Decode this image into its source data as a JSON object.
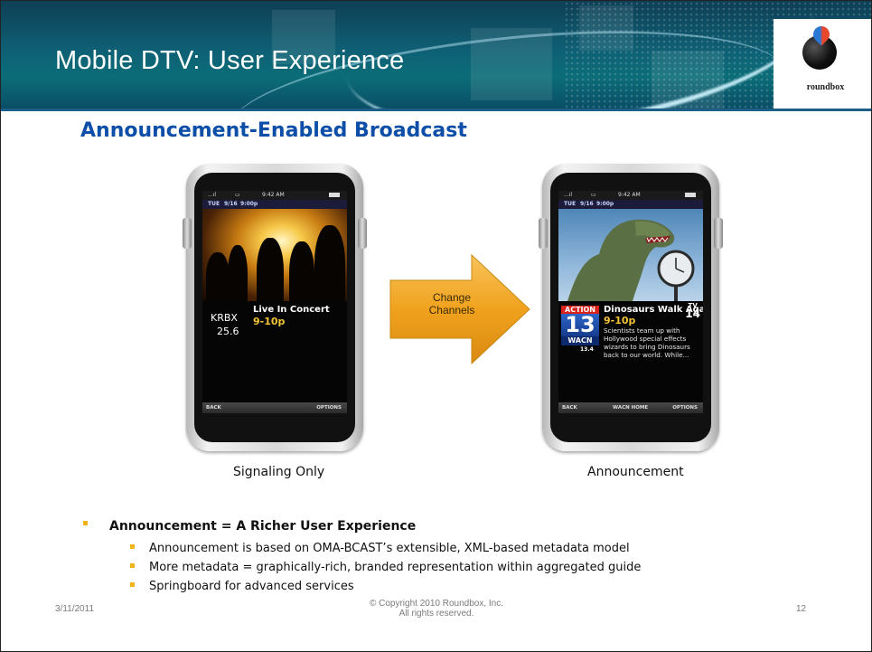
{
  "header": {
    "title": "Mobile DTV: User Experience",
    "logo_text": "roundbox"
  },
  "subtitle": "Announcement-Enabled Broadcast",
  "phone_left": {
    "status": {
      "signal": "...ıl",
      "battery_glyph": "▭",
      "time": "9:42 AM"
    },
    "date": {
      "day": "TUE",
      "date": "9/16",
      "time": "9:00p"
    },
    "channel_call": "KRBX",
    "channel_num": "25.6",
    "program_title": "Live In Concert",
    "program_time": "9-10p",
    "back_label": "BACK",
    "options_label": "OPTIONS",
    "caption": "Signaling Only"
  },
  "arrow_label": "Change Channels",
  "phone_right": {
    "status": {
      "signal": "...ıl",
      "battery_glyph": "▭",
      "time": "9:42 AM"
    },
    "date": {
      "day": "TUE",
      "date": "9/16",
      "time": "9:00p"
    },
    "station_logo_top": "ACTION",
    "station_logo_num": "13",
    "station_logo_call": "WACN",
    "channel_num": "13.4",
    "program_title": "Dinosaurs Walk Again",
    "program_time": "9-10p",
    "rating_top": "TV",
    "rating_num": "14",
    "description": "Scientists team up with Hollywood special effects wizards to bring Dinosaurs back to our world. While...",
    "back_label": "BACK",
    "home_label": "WACN HOME",
    "options_label": "OPTIONS",
    "caption": "Announcement"
  },
  "bullets": {
    "main": "Announcement = A Richer User Experience",
    "subs": [
      "Announcement is based on OMA-BCAST’s extensible, XML-based metadata model",
      "More metadata = graphically-rich, branded representation within aggregated guide",
      "Springboard for advanced services"
    ]
  },
  "footer": {
    "date": "3/11/2011",
    "copyright_line1": "© Copyright 2010 Roundbox, Inc.",
    "copyright_line2": "All rights reserved.",
    "page": "12"
  },
  "colors": {
    "header_teal": "#0f5f74",
    "subtitle_blue": "#0d4fa8",
    "bullet_gold": "#f2b21a",
    "arrow_orange": "#f0a21e",
    "program_time_yellow": "#f2c237"
  }
}
